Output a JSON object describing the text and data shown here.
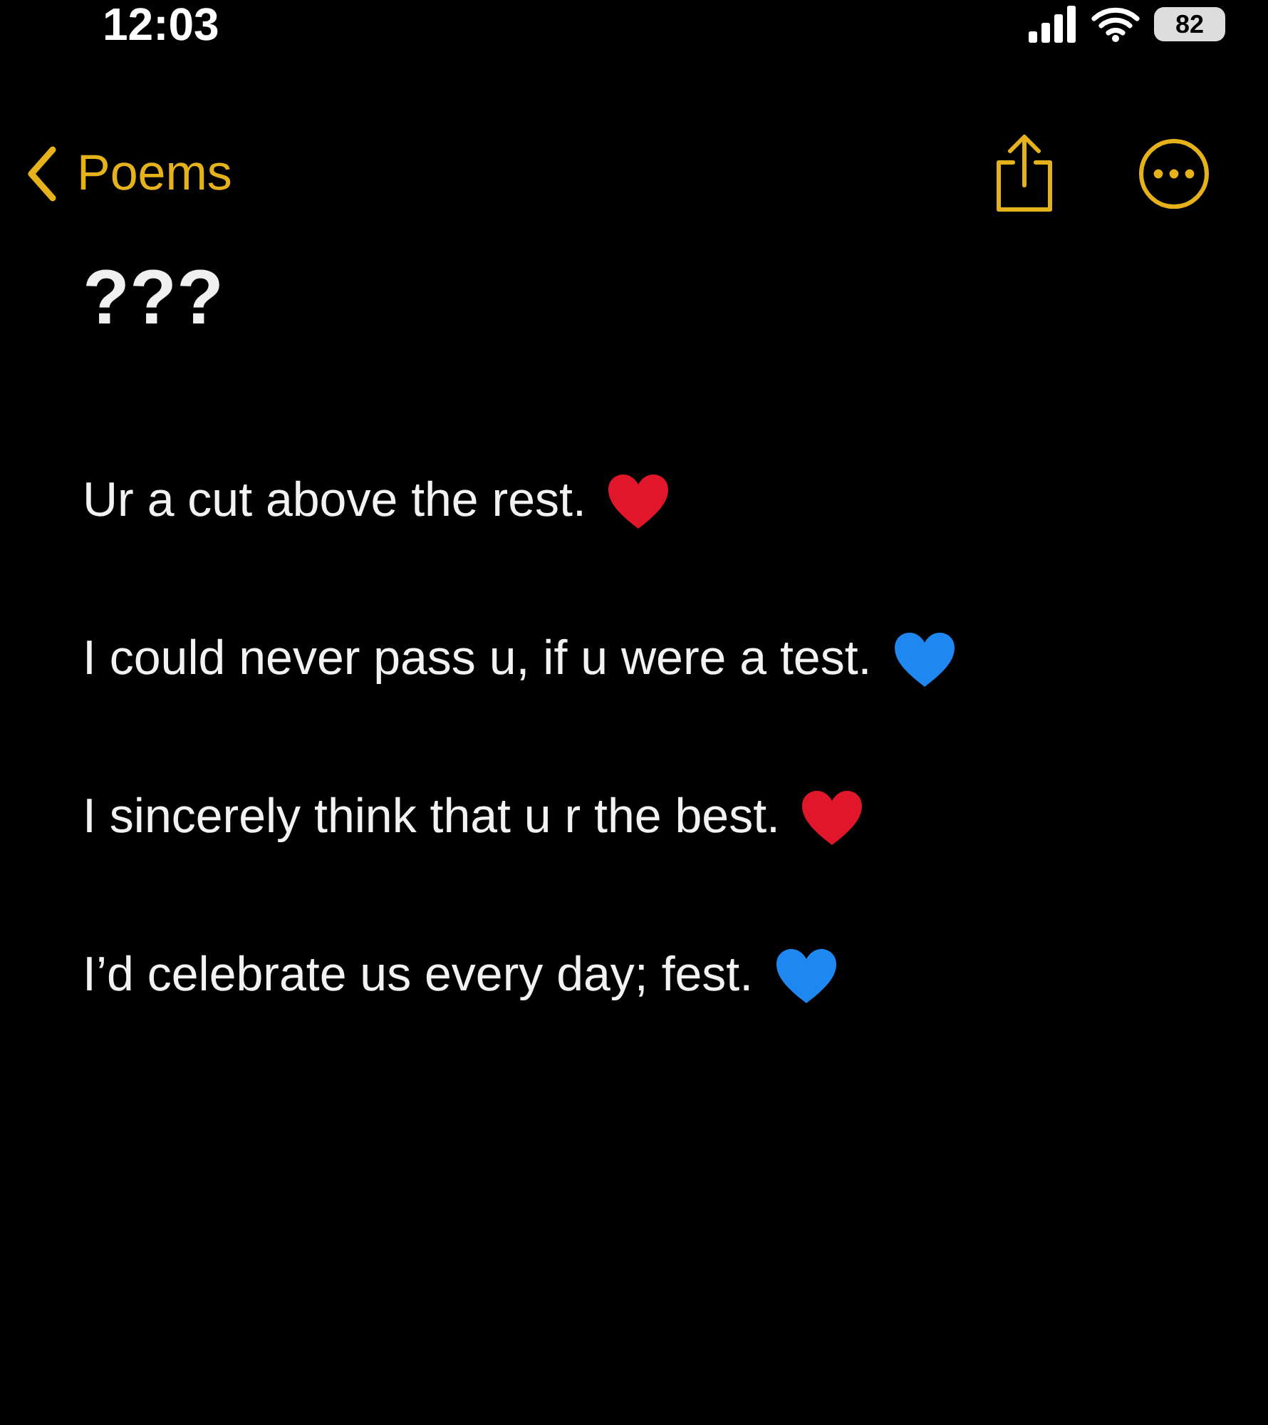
{
  "status_bar": {
    "time": "12:03",
    "battery": "82"
  },
  "nav": {
    "back_label": "Poems"
  },
  "note": {
    "title": "???",
    "lines": [
      {
        "text": "Ur a cut above the rest.",
        "color": "#e0162b"
      },
      {
        "text": "I could never pass u, if u were a test.",
        "color": "#1e88f0"
      },
      {
        "text": "I sincerely think that u r the best.",
        "color": "#e0162b"
      },
      {
        "text": "I’d celebrate us every day; fest.",
        "color": "#1e88f0"
      }
    ]
  }
}
